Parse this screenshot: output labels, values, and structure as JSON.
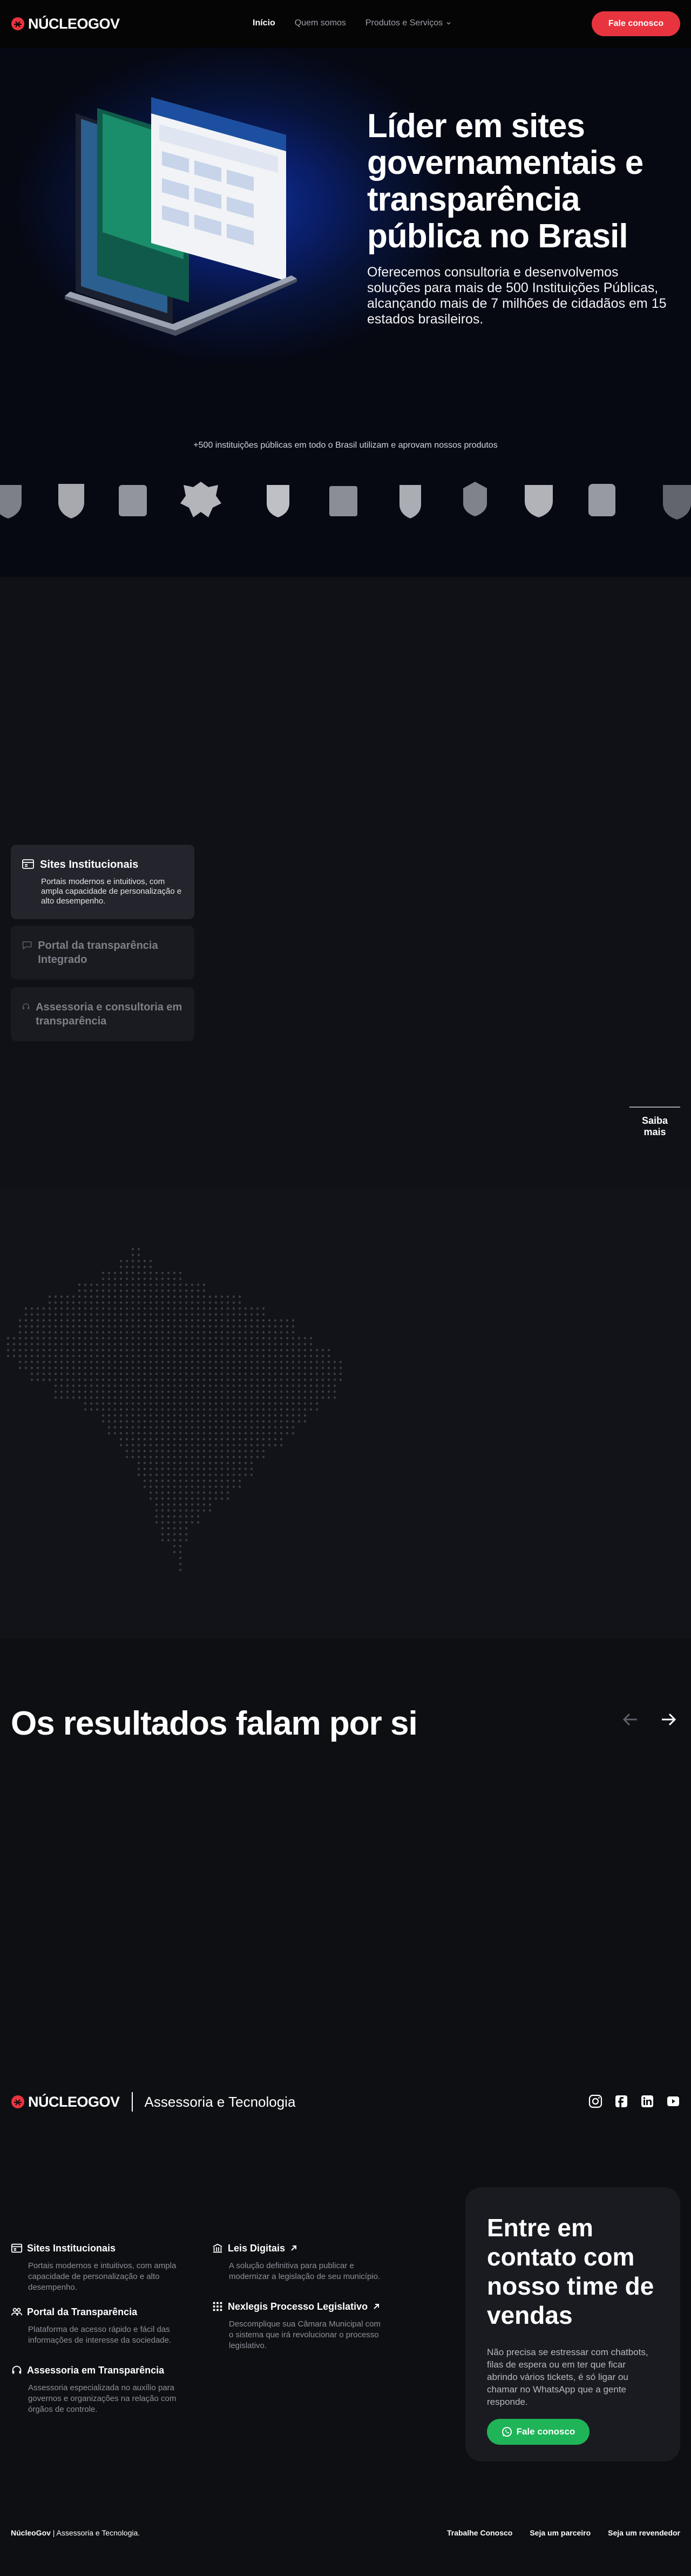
{
  "colors": {
    "accent": "#e8343f",
    "success": "#1fb457",
    "bg": "#0e0f13"
  },
  "nav": {
    "brand": "NÚCLEOGOV",
    "links": [
      {
        "label": "Início",
        "active": true
      },
      {
        "label": "Quem somos"
      },
      {
        "label": "Produtos e Serviços",
        "icon": "chevron-down-icon"
      }
    ],
    "cta": "Fale conosco"
  },
  "hero": {
    "title": "Líder em sites governamentais e transparência pública no Brasil",
    "lead": "Oferecemos consultoria e desenvolvemos soluções para mais de 500 Instituições Públicas, alcançando mais de 7 milhões de cidadãos em 15 estados brasileiros.",
    "institutions_caption": "+500 instituições públicas em todo o Brasil utilizam e aprovam nossos produtos"
  },
  "products": {
    "cards": [
      {
        "title": "Sites Institucionais",
        "desc": "Portais modernos e intuitivos, com ampla capacidade de personalização e alto desempenho.",
        "icon": "browser-icon",
        "active": true
      },
      {
        "title": "Portal da transparência Integrado",
        "icon": "chat-icon",
        "active": false
      },
      {
        "title": "Assessoria e consultoria em transparência",
        "icon": "support-icon",
        "active": false
      }
    ],
    "more": "Saiba mais"
  },
  "results": {
    "title": "Os resultados falam por si"
  },
  "footer": {
    "brand": "NÚCLEOGOV",
    "tagline": "Assessoria e Tecnologia",
    "socials": [
      "instagram-icon",
      "facebook-icon",
      "linkedin-icon",
      "youtube-icon"
    ],
    "col1": [
      {
        "title": "Sites Institucionais",
        "desc": "Portais modernos e intuitivos, com ampla capacidade de personalização e alto desempenho.",
        "icon": "browser-icon"
      },
      {
        "title": "Portal da Transparência",
        "desc": "Plataforma de acesso rápido e fácil das informações de interesse da sociedade.",
        "icon": "people-icon"
      },
      {
        "title": "Assessoria em Transparência",
        "desc": "Assessoria especializada no auxílio para governos e organizações na relação com órgãos de controle.",
        "icon": "support-icon"
      }
    ],
    "col2": [
      {
        "title": "Leis Digitais",
        "desc": "A solução definitiva para publicar e modernizar a legislação de seu município.",
        "icon": "building-icon"
      },
      {
        "title": "Nexlegis Processo Legislativo",
        "desc": "Descomplique sua Câmara Municipal com o sistema que irá revolucionar o processo legislativo.",
        "icon": "grid-icon"
      }
    ],
    "contact": {
      "title": "Entre em contato com nosso time de vendas",
      "text": "Não precisa se estressar com chatbots, filas de espera ou em ter que ficar abrindo vários tickets, é só ligar ou chamar no WhatsApp que a gente responde.",
      "cta": "Fale conosco"
    },
    "copyright_brand": "NúcleoGov",
    "copyright_text": " | Assessoria e Tecnologia.",
    "links": [
      "Trabalhe Conosco",
      "Seja um parceiro",
      "Seja um revendedor"
    ]
  }
}
